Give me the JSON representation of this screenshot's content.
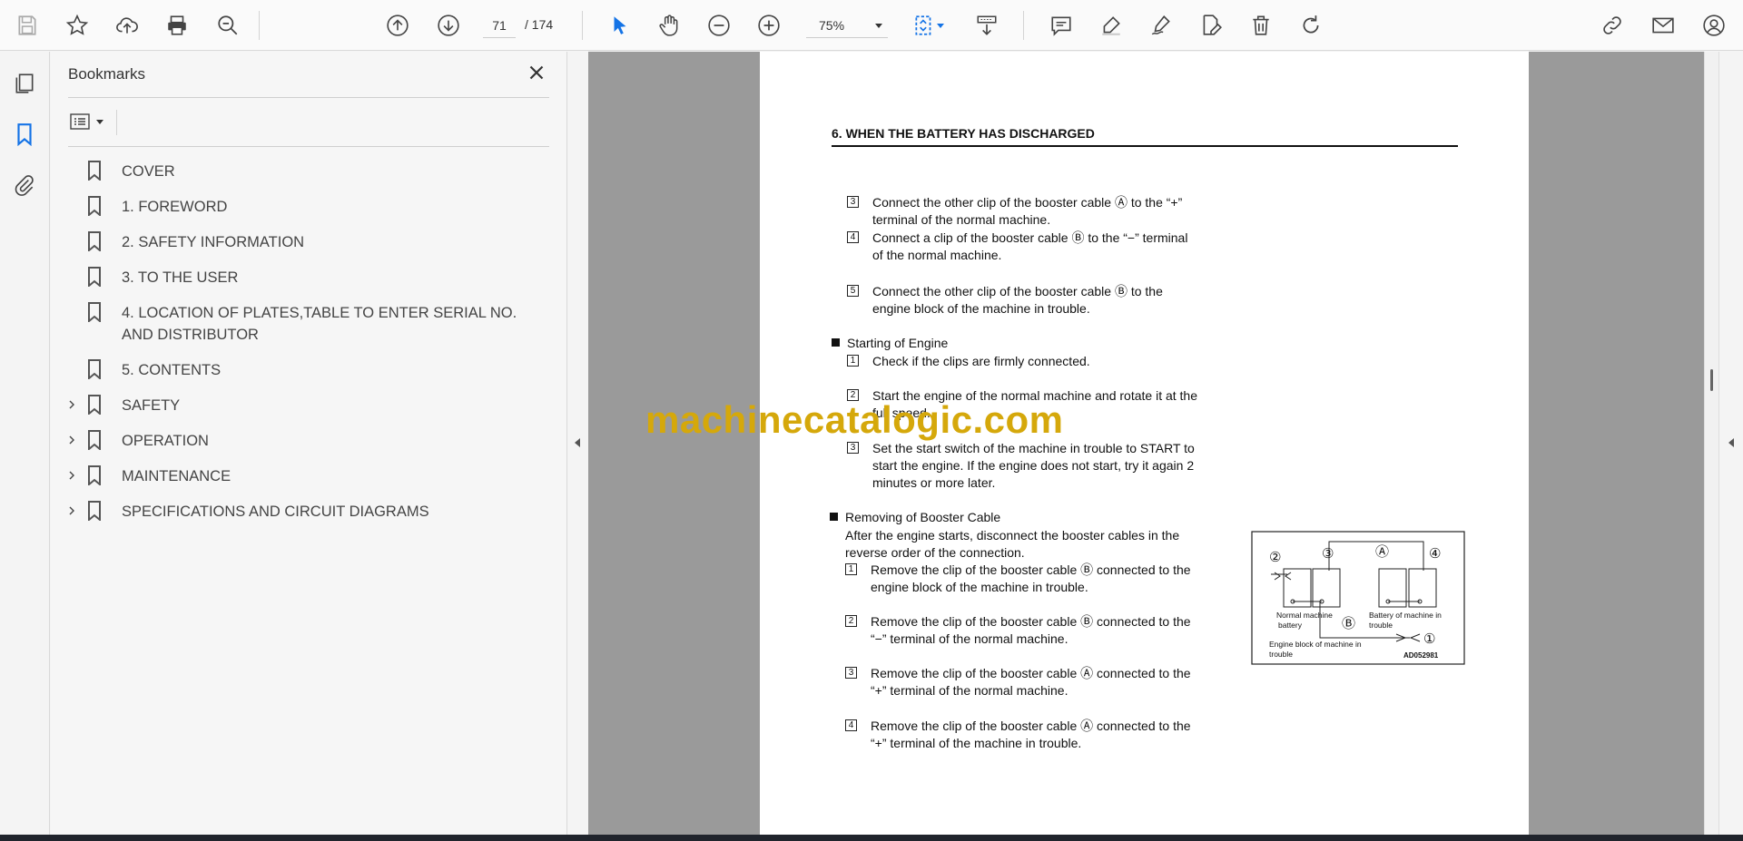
{
  "toolbar": {
    "page_current": "71",
    "page_total": "/  174",
    "zoom": "75%",
    "icons": [
      "save-icon",
      "bookmark-star-icon",
      "upload-cloud-icon",
      "print-icon",
      "zoom-search-icon",
      "page-up-icon",
      "page-down-icon",
      "select-arrow-icon",
      "hand-icon",
      "zoom-out-icon",
      "zoom-in-icon",
      "fit-page-icon",
      "scroll-mode-icon",
      "comment-icon",
      "highlight-icon",
      "sign-icon",
      "edit-pdf-icon",
      "delete-icon",
      "rotate-icon",
      "share-link-icon",
      "email-icon",
      "account-icon"
    ]
  },
  "rail": {
    "icons": [
      "pages-icon",
      "bookmarks-icon",
      "attachments-icon"
    ]
  },
  "panel": {
    "title": "Bookmarks",
    "bookmarks": [
      {
        "label": "COVER",
        "expandable": false
      },
      {
        "label": "1. FOREWORD",
        "expandable": false
      },
      {
        "label": "2. SAFETY INFORMATION",
        "expandable": false
      },
      {
        "label": "3. TO THE USER",
        "expandable": false
      },
      {
        "label": "4. LOCATION OF PLATES,TABLE TO ENTER SERIAL NO. AND DISTRIBUTOR",
        "expandable": false
      },
      {
        "label": "5. CONTENTS",
        "expandable": false
      },
      {
        "label": "SAFETY",
        "expandable": true
      },
      {
        "label": "OPERATION",
        "expandable": true
      },
      {
        "label": "MAINTENANCE",
        "expandable": true
      },
      {
        "label": "SPECIFICATIONS AND CIRCUIT DIAGRAMS",
        "expandable": true
      }
    ]
  },
  "document": {
    "heading": "6.  WHEN THE BATTERY HAS DISCHARGED",
    "items": [
      {
        "num": "3",
        "line1": "Connect the other clip of the booster cable Ⓐ to the “+”",
        "line2": "terminal of the normal machine."
      },
      {
        "num": "4",
        "line1": "Connect a clip of the booster cable Ⓑ to the “−” terminal",
        "line2": "of the normal machine."
      },
      {
        "num": "5",
        "line1": "Connect the other clip of the booster cable Ⓑ to the",
        "line2": "engine block of the machine in trouble."
      }
    ],
    "section1": {
      "title": "Starting of Engine",
      "items": [
        {
          "num": "1",
          "line1": "Check if the clips are firmly connected.",
          "line2": ""
        },
        {
          "num": "2",
          "line1": "Start the engine of the normal machine and rotate it at the",
          "line2": "full speed."
        },
        {
          "num": "3",
          "line1": "Set the start switch of the machine in trouble to START to",
          "line2": "start the engine.  If the engine does not start, try it again 2",
          "line3": "minutes or more later."
        }
      ]
    },
    "section2": {
      "title": "Removing of Booster Cable",
      "intro1": "After the engine starts, disconnect the booster cables in the",
      "intro2": "reverse order of the connection.",
      "items": [
        {
          "num": "1",
          "line1": "Remove the clip of the booster cable Ⓑ connected to the",
          "line2": "engine block of the machine in trouble."
        },
        {
          "num": "2",
          "line1": "Remove the clip of the booster cable Ⓑ connected to the",
          "line2": "“−” terminal of the normal machine."
        },
        {
          "num": "3",
          "line1": "Remove the clip of the booster cable Ⓐ connected to the",
          "line2": "“+” terminal of the normal machine."
        },
        {
          "num": "4",
          "line1": "Remove the clip of the booster cable Ⓐ connected to the",
          "line2": "“+” terminal of the machine in trouble."
        }
      ]
    },
    "figure": {
      "label_normal": "Normal machine",
      "label_normal2": "battery",
      "label_trouble": "Battery of machine in",
      "label_trouble2": "trouble",
      "label_block": "Engine block of machine in",
      "label_block2": "trouble",
      "code": "AD052981",
      "callouts": [
        "②",
        "③",
        "Ⓐ",
        "④",
        "Ⓑ",
        "①"
      ]
    },
    "watermark": "machinecatalogic.com"
  }
}
